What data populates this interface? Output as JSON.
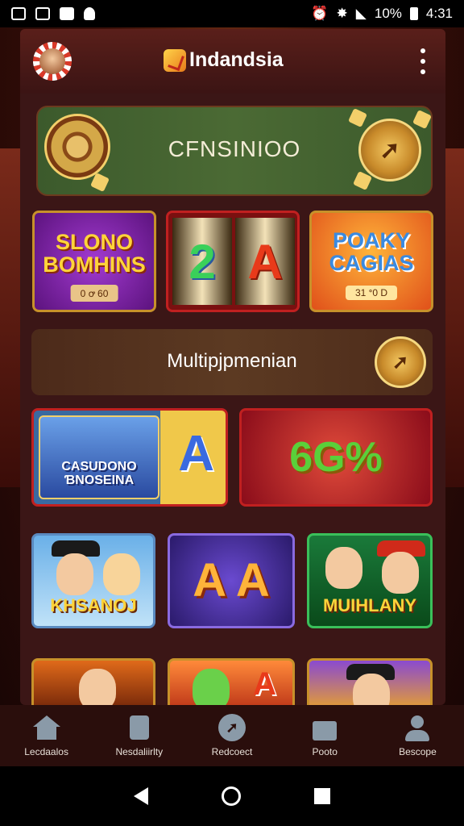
{
  "status_bar": {
    "battery": "10%",
    "time": "4:31"
  },
  "header": {
    "app_name": "Indandsia"
  },
  "casino_banner": {
    "title": "CFNSINIOO"
  },
  "tiles_row1": [
    {
      "label": "SLONO BOMHINS",
      "sub": "0 ꝍ 60"
    },
    {
      "reel_1": "2",
      "reel_2": "A"
    },
    {
      "label": "POAKY CAGIAS",
      "sub": "31 ᐤ0 D"
    }
  ],
  "multiplayer": {
    "title": "Multipjpmenian"
  },
  "tiles_row2": [
    {
      "label": "CASUDONO ƁNOSEINA",
      "big": "A"
    },
    {
      "label": "6G%"
    }
  ],
  "tiles_row3": [
    {
      "label": "KHSANOJ"
    },
    {
      "label": "A A"
    },
    {
      "label": "MUIHLANY"
    }
  ],
  "tiles_row4": [
    {
      "label": ""
    },
    {
      "label": "A"
    },
    {
      "label": ""
    }
  ],
  "bottom_nav": [
    {
      "label": "Lecdaalos",
      "icon": "home-icon"
    },
    {
      "label": "Nesdaliirlty",
      "icon": "bag-icon"
    },
    {
      "label": "Redcoect",
      "icon": "chat-icon"
    },
    {
      "label": "Pooto",
      "icon": "briefcase-icon"
    },
    {
      "label": "Bescope",
      "icon": "profile-icon"
    }
  ],
  "colors": {
    "panel": "#3b1616",
    "banner_green": "#4b6a34",
    "gold": "#c7912a"
  }
}
